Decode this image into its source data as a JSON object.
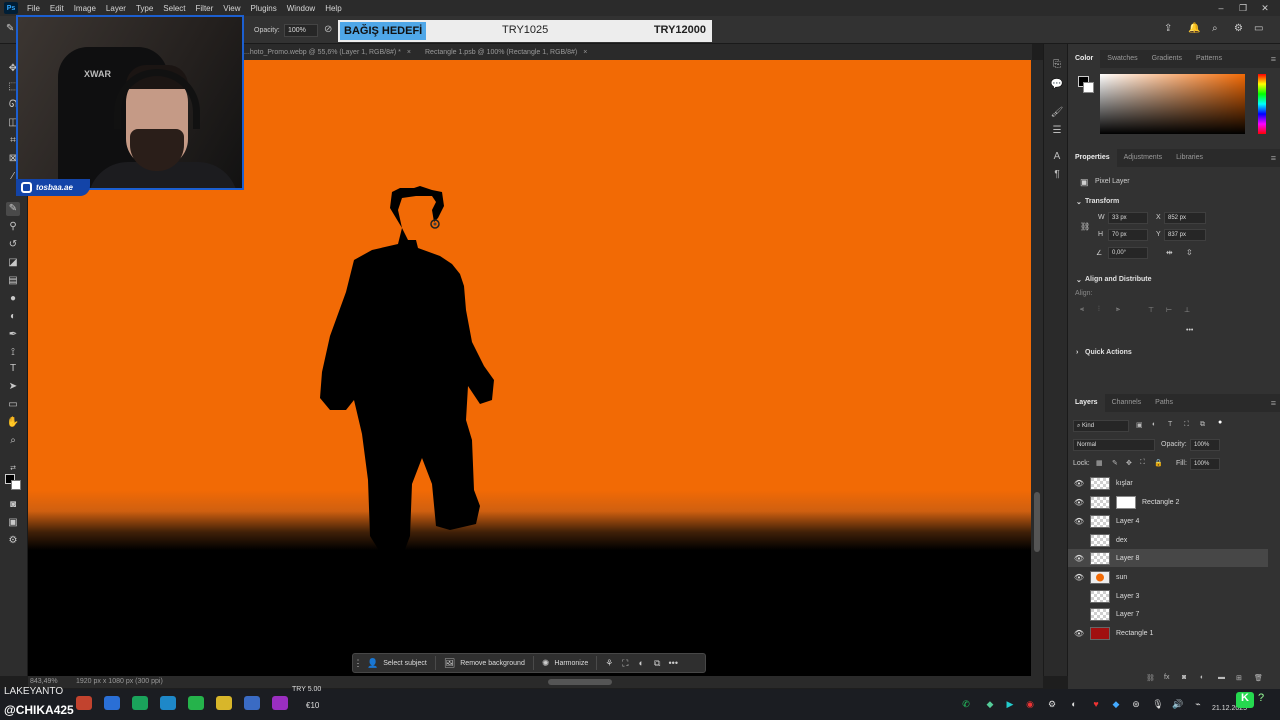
{
  "menu": {
    "items": [
      "File",
      "Edit",
      "Image",
      "Layer",
      "Type",
      "Select",
      "Filter",
      "View",
      "Plugins",
      "Window",
      "Help"
    ]
  },
  "options_bar": {
    "opacity_label": "Opacity:",
    "opacity_value": "100%"
  },
  "donation_overlay": {
    "title": "BAĞIŞ HEDEFİ",
    "current": "TRY1025",
    "goal": "TRY12000",
    "highlight_color": "#4fa7e8"
  },
  "doc_tabs": [
    {
      "label": "...hoto_Promo.webp @ 55,6% (Layer 1, RGB/8#) *",
      "close": "×"
    },
    {
      "label": "Rectangle 1.psb @ 100% (Rectangle 1, RGB/8#)",
      "close": "×"
    }
  ],
  "canvas": {
    "sky_color": "#f26a05",
    "ground_color": "#000000"
  },
  "status": {
    "zoom": "843,49%",
    "doc_size": "1920 px x 1080 px (300 ppi)"
  },
  "context_bar": {
    "select_subject": "Select subject",
    "remove_background": "Remove background",
    "harmonize": "Harmonize",
    "more": "•••"
  },
  "color_panel": {
    "tabs": [
      "Color",
      "Swatches",
      "Gradients",
      "Patterns"
    ],
    "active": "Color"
  },
  "properties_panel": {
    "tabs": [
      "Properties",
      "Adjustments",
      "Libraries"
    ],
    "layer_type": "Pixel Layer",
    "transform_label": "Transform",
    "w_label": "W",
    "w_value": "33 px",
    "h_label": "H",
    "h_value": "70 px",
    "x_label": "X",
    "x_value": "852 px",
    "y_label": "Y",
    "y_value": "837 px",
    "angle_value": "0,00°",
    "align_distribute": "Align and Distribute",
    "align_label": "Align:",
    "quick_actions": "Quick Actions",
    "more": "•••"
  },
  "layers_panel": {
    "tabs": [
      "Layers",
      "Channels",
      "Paths"
    ],
    "kind_label": "Kind",
    "blend_mode": "Normal",
    "opacity_label": "Opacity:",
    "opacity_value": "100%",
    "lock_label": "Lock:",
    "fill_label": "Fill:",
    "fill_value": "100%",
    "layers": [
      {
        "name": "kışlar",
        "visible": true,
        "thumb": "transparent"
      },
      {
        "name": "Rectangle 2",
        "visible": true,
        "thumb": "mask"
      },
      {
        "name": "Layer 4",
        "visible": true,
        "thumb": "transparent"
      },
      {
        "name": "dex",
        "visible": false,
        "thumb": "transparent"
      },
      {
        "name": "Layer 8",
        "visible": true,
        "thumb": "transparent",
        "selected": true
      },
      {
        "name": "sun",
        "visible": true,
        "thumb": "orange"
      },
      {
        "name": "Layer 3",
        "visible": false,
        "thumb": "transparent"
      },
      {
        "name": "Layer 7",
        "visible": false,
        "thumb": "transparent"
      },
      {
        "name": "Rectangle 1",
        "visible": true,
        "thumb": "red"
      }
    ]
  },
  "webcam": {
    "brand_text": "XWAR",
    "instagram_handle": "tosbaa.ae"
  },
  "taskbar": {
    "streamer_top": "LAKEYANTO",
    "streamer_handle": "@CHIKA425",
    "try_amount": "TRY 5.00",
    "eur_amount": "€10",
    "date": "21.12.2025"
  }
}
